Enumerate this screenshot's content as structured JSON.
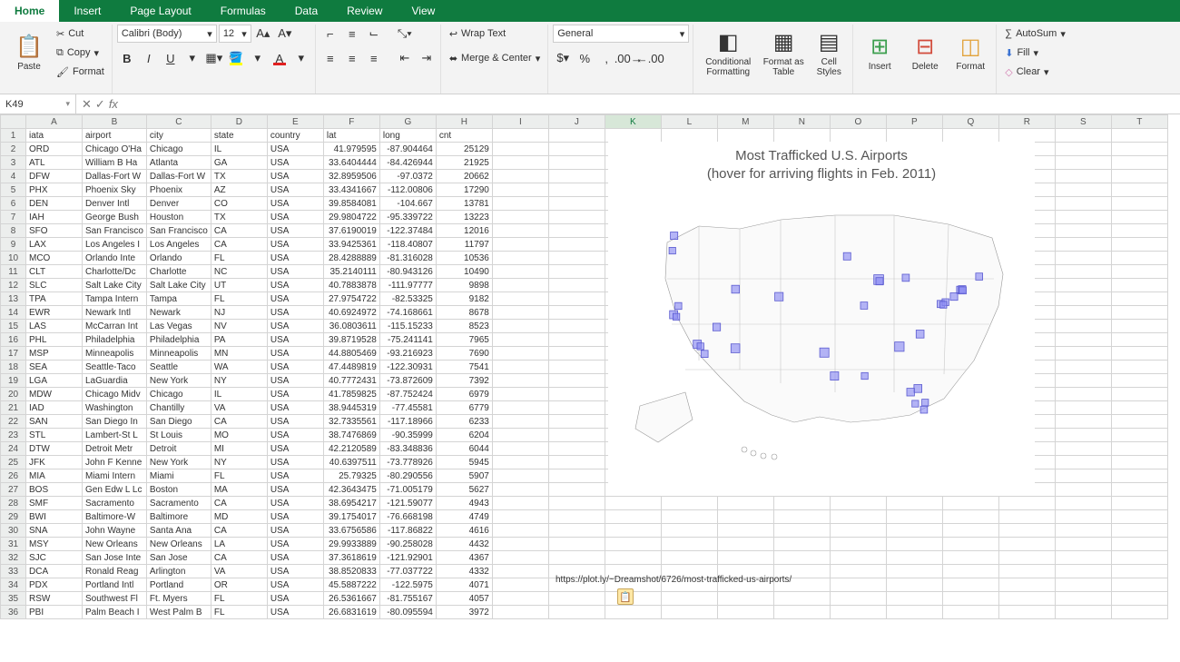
{
  "tabs": [
    "Home",
    "Insert",
    "Page Layout",
    "Formulas",
    "Data",
    "Review",
    "View"
  ],
  "activeTab": "Home",
  "clipboard": {
    "paste": "Paste",
    "cut": "Cut",
    "copy": "Copy",
    "format": "Format"
  },
  "font": {
    "name": "Calibri (Body)",
    "size": "12",
    "bold": "B",
    "italic": "I",
    "underline": "U"
  },
  "align": {
    "wrap": "Wrap Text",
    "merge": "Merge & Center"
  },
  "number": {
    "format": "General"
  },
  "styles": {
    "cond": "Conditional Formatting",
    "table": "Format as Table",
    "cell": "Cell Styles"
  },
  "cells": {
    "insert": "Insert",
    "delete": "Delete",
    "format": "Format"
  },
  "editing": {
    "sum": "AutoSum",
    "fill": "Fill",
    "clear": "Clear"
  },
  "namebox": "K49",
  "columns": [
    "A",
    "B",
    "C",
    "D",
    "E",
    "F",
    "G",
    "H",
    "I",
    "J",
    "K",
    "L",
    "M",
    "N",
    "O",
    "P",
    "Q",
    "R",
    "S",
    "T"
  ],
  "activeCol": "K",
  "headers": [
    "iata",
    "airport",
    "city",
    "state",
    "country",
    "lat",
    "long",
    "cnt"
  ],
  "rows": [
    [
      "ORD",
      "Chicago O'Ha",
      "Chicago",
      "IL",
      "USA",
      "41.979595",
      "-87.904464",
      "25129"
    ],
    [
      "ATL",
      "William B Ha",
      "Atlanta",
      "GA",
      "USA",
      "33.6404444",
      "-84.426944",
      "21925"
    ],
    [
      "DFW",
      "Dallas-Fort W",
      "Dallas-Fort W",
      "TX",
      "USA",
      "32.8959506",
      "-97.0372",
      "20662"
    ],
    [
      "PHX",
      "Phoenix Sky",
      "Phoenix",
      "AZ",
      "USA",
      "33.4341667",
      "-112.00806",
      "17290"
    ],
    [
      "DEN",
      "Denver Intl",
      "Denver",
      "CO",
      "USA",
      "39.8584081",
      "-104.667",
      "13781"
    ],
    [
      "IAH",
      "George Bush",
      "Houston",
      "TX",
      "USA",
      "29.9804722",
      "-95.339722",
      "13223"
    ],
    [
      "SFO",
      "San Francisco",
      "San Francisco",
      "CA",
      "USA",
      "37.6190019",
      "-122.37484",
      "12016"
    ],
    [
      "LAX",
      "Los Angeles I",
      "Los Angeles",
      "CA",
      "USA",
      "33.9425361",
      "-118.40807",
      "11797"
    ],
    [
      "MCO",
      "Orlando Inte",
      "Orlando",
      "FL",
      "USA",
      "28.4288889",
      "-81.316028",
      "10536"
    ],
    [
      "CLT",
      "Charlotte/Dc",
      "Charlotte",
      "NC",
      "USA",
      "35.2140111",
      "-80.943126",
      "10490"
    ],
    [
      "SLC",
      "Salt Lake City",
      "Salt Lake City",
      "UT",
      "USA",
      "40.7883878",
      "-111.97777",
      "9898"
    ],
    [
      "TPA",
      "Tampa Intern",
      "Tampa",
      "FL",
      "USA",
      "27.9754722",
      "-82.53325",
      "9182"
    ],
    [
      "EWR",
      "Newark Intl",
      "Newark",
      "NJ",
      "USA",
      "40.6924972",
      "-74.168661",
      "8678"
    ],
    [
      "LAS",
      "McCarran Int",
      "Las Vegas",
      "NV",
      "USA",
      "36.0803611",
      "-115.15233",
      "8523"
    ],
    [
      "PHL",
      "Philadelphia",
      "Philadelphia",
      "PA",
      "USA",
      "39.8719528",
      "-75.241141",
      "7965"
    ],
    [
      "MSP",
      "Minneapolis",
      "Minneapolis",
      "MN",
      "USA",
      "44.8805469",
      "-93.216923",
      "7690"
    ],
    [
      "SEA",
      "Seattle-Taco",
      "Seattle",
      "WA",
      "USA",
      "47.4489819",
      "-122.30931",
      "7541"
    ],
    [
      "LGA",
      "LaGuardia",
      "New York",
      "NY",
      "USA",
      "40.7772431",
      "-73.872609",
      "7392"
    ],
    [
      "MDW",
      "Chicago Midv",
      "Chicago",
      "IL",
      "USA",
      "41.7859825",
      "-87.752424",
      "6979"
    ],
    [
      "IAD",
      "Washington",
      "Chantilly",
      "VA",
      "USA",
      "38.9445319",
      "-77.45581",
      "6779"
    ],
    [
      "SAN",
      "San Diego In",
      "San Diego",
      "CA",
      "USA",
      "32.7335561",
      "-117.18966",
      "6233"
    ],
    [
      "STL",
      "Lambert-St L",
      "St Louis",
      "MO",
      "USA",
      "38.7476869",
      "-90.35999",
      "6204"
    ],
    [
      "DTW",
      "Detroit Metr",
      "Detroit",
      "MI",
      "USA",
      "42.2120589",
      "-83.348836",
      "6044"
    ],
    [
      "JFK",
      "John F Kenne",
      "New York",
      "NY",
      "USA",
      "40.6397511",
      "-73.778926",
      "5945"
    ],
    [
      "MIA",
      "Miami Intern",
      "Miami",
      "FL",
      "USA",
      "25.79325",
      "-80.290556",
      "5907"
    ],
    [
      "BOS",
      "Gen Edw L Lc",
      "Boston",
      "MA",
      "USA",
      "42.3643475",
      "-71.005179",
      "5627"
    ],
    [
      "SMF",
      "Sacramento",
      "Sacramento",
      "CA",
      "USA",
      "38.6954217",
      "-121.59077",
      "4943"
    ],
    [
      "BWI",
      "Baltimore-W",
      "Baltimore",
      "MD",
      "USA",
      "39.1754017",
      "-76.668198",
      "4749"
    ],
    [
      "SNA",
      "John Wayne",
      "Santa Ana",
      "CA",
      "USA",
      "33.6756586",
      "-117.86822",
      "4616"
    ],
    [
      "MSY",
      "New Orleans",
      "New Orleans",
      "LA",
      "USA",
      "29.9933889",
      "-90.258028",
      "4432"
    ],
    [
      "SJC",
      "San Jose Inte",
      "San Jose",
      "CA",
      "USA",
      "37.3618619",
      "-121.92901",
      "4367"
    ],
    [
      "DCA",
      "Ronald Reag",
      "Arlington",
      "VA",
      "USA",
      "38.8520833",
      "-77.037722",
      "4332"
    ],
    [
      "PDX",
      "Portland Intl",
      "Portland",
      "OR",
      "USA",
      "45.5887222",
      "-122.5975",
      "4071"
    ],
    [
      "RSW",
      "Southwest Fl",
      "Ft. Myers",
      "FL",
      "USA",
      "26.5361667",
      "-81.755167",
      "4057"
    ],
    [
      "PBI",
      "Palm Beach I",
      "West Palm B",
      "FL",
      "USA",
      "26.6831619",
      "-80.095594",
      "3972"
    ]
  ],
  "chart": {
    "title1": "Most Trafficked U.S. Airports",
    "title2": "(hover for arriving flights in Feb. 2011)"
  },
  "linkRow": 33,
  "linkCol": "J",
  "linkText": "https://plot.ly/~Dreamshot/6726/most-trafficked-us-airports/",
  "chart_data": {
    "type": "scatter",
    "title": "Most Trafficked U.S. Airports (hover for arriving flights in Feb. 2011)",
    "xlabel": "long",
    "ylabel": "lat",
    "xlim": [
      -125,
      -67
    ],
    "ylim": [
      24,
      50
    ],
    "note": "scatter on US map outline, size ~ cnt",
    "series": [
      {
        "name": "airports",
        "x_field": "long",
        "y_field": "lat",
        "size_field": "cnt"
      }
    ]
  }
}
